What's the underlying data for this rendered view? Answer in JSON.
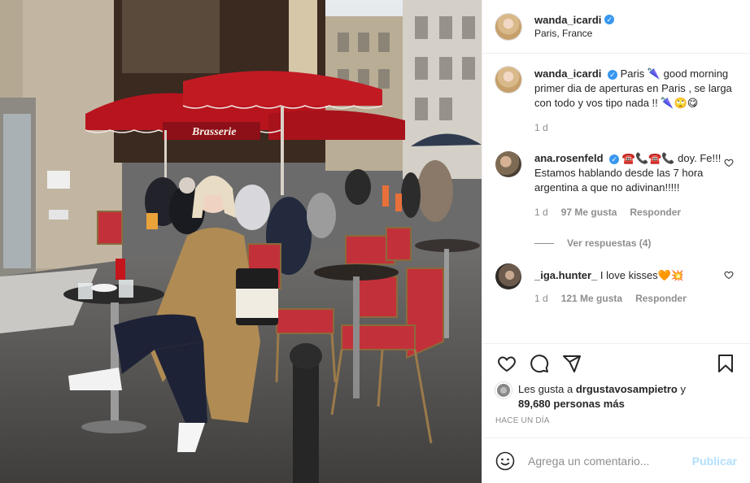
{
  "post": {
    "image_alt": "Woman sitting at a Paris café terrace",
    "sign_text": "Brasserie",
    "author": {
      "username": "wanda_icardi",
      "verified": true,
      "location": "Paris, France"
    },
    "caption": {
      "username": "wanda_icardi",
      "text": "Paris 🌂 good morning primer dia de aperturas en Paris , se larga con todo y vos tipo nada !! 🌂🙄😋",
      "time": "1 d"
    },
    "comments": [
      {
        "username": "ana.rosenfeld",
        "verified": true,
        "text": "☎️📞☎️📞 doy. Fe!!! Estamos hablando desde las 7 hora argentina a que no adivinan!!!!!",
        "time": "1 d",
        "likes": "97 Me gusta",
        "reply_label": "Responder",
        "view_replies": "Ver respuestas (4)"
      },
      {
        "username": "_iga.hunter_",
        "verified": false,
        "text": "I love kisses🧡💥",
        "time": "1 d",
        "likes": "121 Me gusta",
        "reply_label": "Responder"
      }
    ],
    "likes_line": {
      "prefix": "Les gusta a",
      "user": "drgustavosampietro",
      "joiner": "y",
      "count": "89,680 personas más"
    },
    "posted_ago": "HACE UN DÍA",
    "add_comment": {
      "placeholder": "Agrega un comentario...",
      "publish_label": "Publicar"
    }
  },
  "icons": [
    "verified-badge",
    "heart-icon",
    "comment-icon",
    "share-icon",
    "bookmark-icon",
    "emoji-icon"
  ],
  "colors": {
    "accent_blue": "#3897f0",
    "publish_disabled": "#b2dffc",
    "text_primary": "#262626",
    "text_secondary": "#8e8e8e",
    "awning_red": "#b8141e"
  }
}
